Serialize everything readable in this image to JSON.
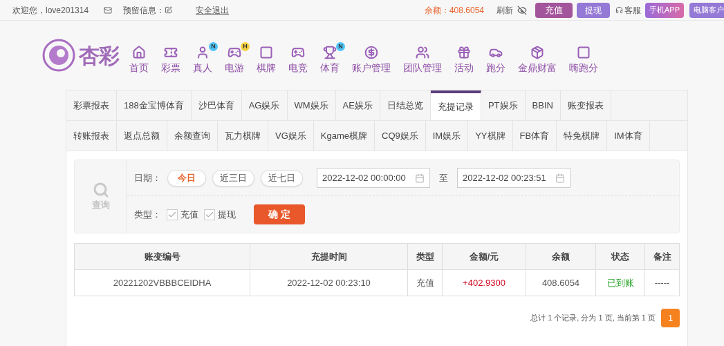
{
  "top_bar": {
    "welcome": "欢迎您，love201314",
    "reserved_label": "预留信息：",
    "logout": "安全退出",
    "balance": "余额：408.6054",
    "refresh": "刷新",
    "deposit": "充值",
    "withdraw": "提现",
    "service": "客服",
    "mobile_app": "手机APP",
    "pc_client": "电脑客户"
  },
  "logo": {
    "text": "杏彩"
  },
  "nav": [
    {
      "label": "首页"
    },
    {
      "label": "彩票"
    },
    {
      "label": "真人",
      "badge": "N",
      "color": "#4fc3f7"
    },
    {
      "label": "电游",
      "badge": "H",
      "color": "#f5d142"
    },
    {
      "label": "棋牌"
    },
    {
      "label": "电竞"
    },
    {
      "label": "体育",
      "badge": "N",
      "color": "#4fc3f7"
    },
    {
      "label": "账户管理"
    },
    {
      "label": "团队管理"
    },
    {
      "label": "活动"
    },
    {
      "label": "跑分"
    },
    {
      "label": "金鼎财富"
    },
    {
      "label": "嗨跑分"
    }
  ],
  "tab_rows": [
    [
      {
        "label": "彩票报表",
        "selected": false
      },
      {
        "label": "188金宝博体育",
        "selected": false
      },
      {
        "label": "沙巴体育",
        "selected": false
      },
      {
        "label": "AG娱乐",
        "selected": false
      },
      {
        "label": "WM娱乐",
        "selected": false
      },
      {
        "label": "AE娱乐",
        "selected": false
      },
      {
        "label": "日结总览",
        "selected": false
      },
      {
        "label": "充提记录",
        "selected": true
      },
      {
        "label": "PT娱乐",
        "selected": false
      },
      {
        "label": "BBIN",
        "selected": false
      },
      {
        "label": "账变报表",
        "selected": false
      }
    ],
    [
      {
        "label": "转账报表",
        "selected": false
      },
      {
        "label": "返点总额",
        "selected": false
      },
      {
        "label": "余额查询",
        "selected": false
      },
      {
        "label": "瓦力棋牌",
        "selected": false
      },
      {
        "label": "VG娱乐",
        "selected": false
      },
      {
        "label": "Kgame棋牌",
        "selected": false
      },
      {
        "label": "CQ9娱乐",
        "selected": false
      },
      {
        "label": "IM娱乐",
        "selected": false
      },
      {
        "label": "YY棋牌",
        "selected": false
      },
      {
        "label": "FB体育",
        "selected": false
      },
      {
        "label": "特免棋牌",
        "selected": false
      },
      {
        "label": "IM体育",
        "selected": false
      }
    ]
  ],
  "filter": {
    "side_label": "查询",
    "date_label": "日期：",
    "ranges": [
      {
        "label": "今日",
        "selected": true
      },
      {
        "label": "近三日",
        "selected": false
      },
      {
        "label": "近七日",
        "selected": false
      }
    ],
    "start": "2022-12-02 00:00:00",
    "to": "至",
    "end": "2022-12-02 00:23:51",
    "type_label": "类型：",
    "types": [
      {
        "label": "充值",
        "checked": true
      },
      {
        "label": "提现",
        "checked": true
      }
    ],
    "submit": "确 定"
  },
  "table": {
    "columns": [
      "账变编号",
      "充提时间",
      "类型",
      "金额/元",
      "余额",
      "状态",
      "备注"
    ],
    "rows": [
      [
        "20221202VBBBCEIDHA",
        "2022-12-02 00:23:10",
        "充值",
        "+402.9300",
        "408.6054",
        "已到账",
        "-----"
      ]
    ]
  },
  "pagination": {
    "summary": "总计 1 个记录, 分为 1 页, 当前第 1 页",
    "pages": [
      {
        "label": "1",
        "selected": true
      }
    ]
  }
}
